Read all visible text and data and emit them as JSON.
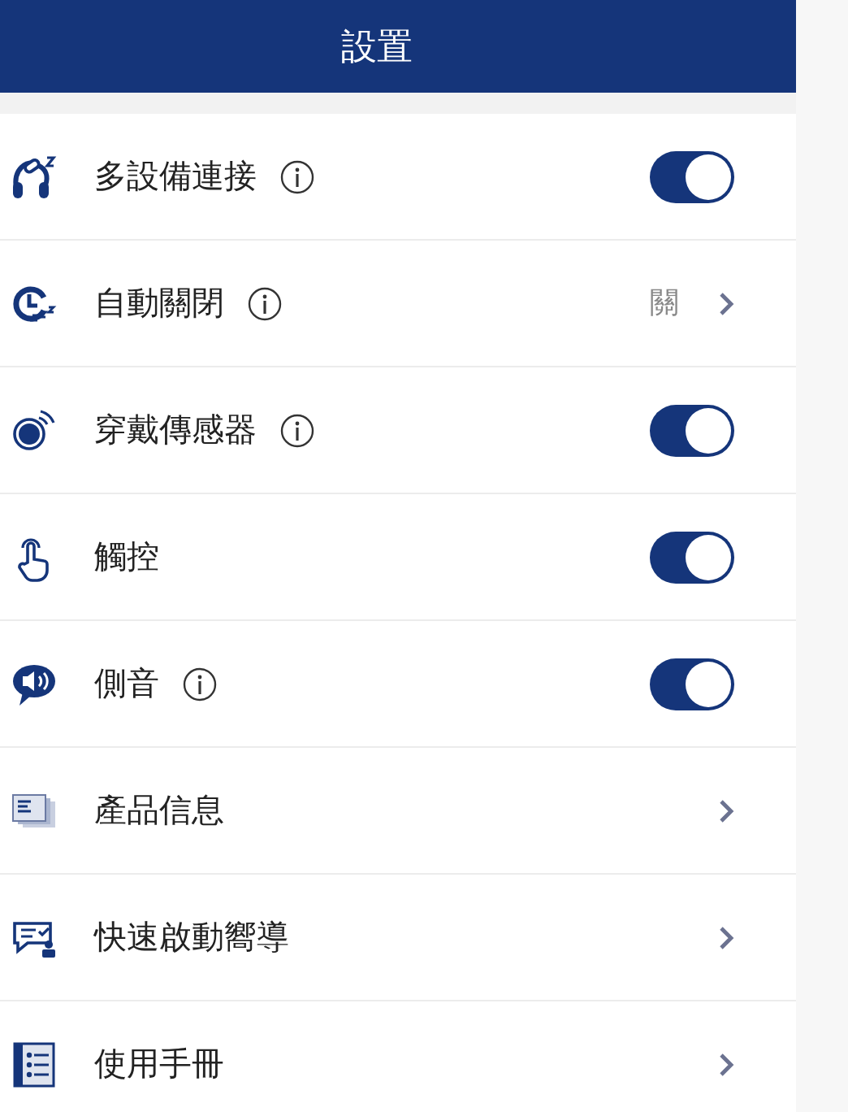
{
  "header": {
    "title": "設置"
  },
  "settings": [
    {
      "kind": "toggle",
      "label": "多設備連接",
      "info": true,
      "on": true
    },
    {
      "kind": "link",
      "label": "自動關閉",
      "info": true,
      "value": "關"
    },
    {
      "kind": "toggle",
      "label": "穿戴傳感器",
      "info": true,
      "on": true
    },
    {
      "kind": "toggle",
      "label": "觸控",
      "info": false,
      "on": true
    },
    {
      "kind": "toggle",
      "label": "側音",
      "info": true,
      "on": true
    },
    {
      "kind": "link",
      "label": "產品信息",
      "info": false
    },
    {
      "kind": "link",
      "label": "快速啟動嚮導",
      "info": false
    },
    {
      "kind": "link",
      "label": "使用手冊",
      "info": false
    }
  ]
}
